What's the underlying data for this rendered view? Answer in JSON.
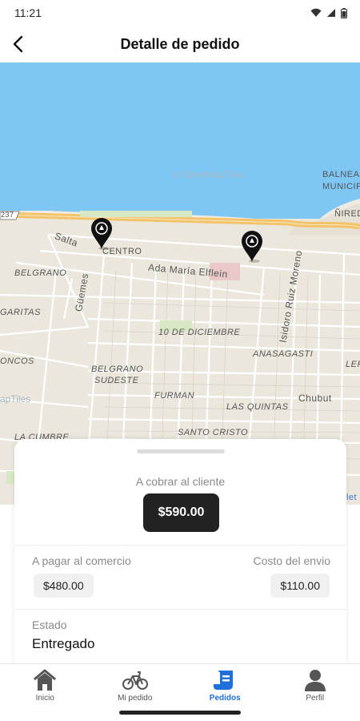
{
  "status_bar": {
    "time": "11:21",
    "icons": [
      "wifi-icon",
      "signal-icon",
      "battery-icon"
    ]
  },
  "header": {
    "title": "Detalle de pedido",
    "back_icon": "arrow-back-icon"
  },
  "map": {
    "attribution": "© OpenMapTiles",
    "road_shield": "237",
    "labels": {
      "salta": "Salta",
      "centro": "CENTRO",
      "ada": "Ada María Elflein",
      "belgrano": "BELGRANO",
      "guemes": "Güemes",
      "garitas": "GARITAS",
      "diciembre": "10 DE DICIEMBRE",
      "isidoro": "Isidoro Ruiz Moreno",
      "anasagasti": "ANASAGASTI",
      "belgrano_sudeste": "BELGRANO SUDESTE",
      "furman": "FURMAN",
      "chubut": "Chubut",
      "las_quintas": "LAS QUINTAS",
      "santo_cristo": "SANTO CRISTO",
      "la_cumbre": "LA CUMBRE",
      "oncos": "ONCOS",
      "balneario": "BALNEA",
      "municipal": "MUNICIPAL",
      "nired": "ÑIRED",
      "ler": "LER",
      "tiles_left": "apTiles",
      "let": "let"
    }
  },
  "order": {
    "collect_label": "A cobrar al cliente",
    "collect_amount": "$590.00",
    "commerce_label": "A pagar al comercio",
    "commerce_amount": "$480.00",
    "shipping_label": "Costo del envio",
    "shipping_amount": "$110.00",
    "state_label": "Estado",
    "state_value": "Entregado"
  },
  "nav": {
    "active_color": "#1e6fd9",
    "items": [
      {
        "label": "Inicio",
        "icon": "home-icon"
      },
      {
        "label": "Mi pedido",
        "icon": "bicycle-icon"
      },
      {
        "label": "Pedidos",
        "icon": "orders-icon",
        "active": true
      },
      {
        "label": "Perfil",
        "icon": "person-icon"
      }
    ]
  }
}
